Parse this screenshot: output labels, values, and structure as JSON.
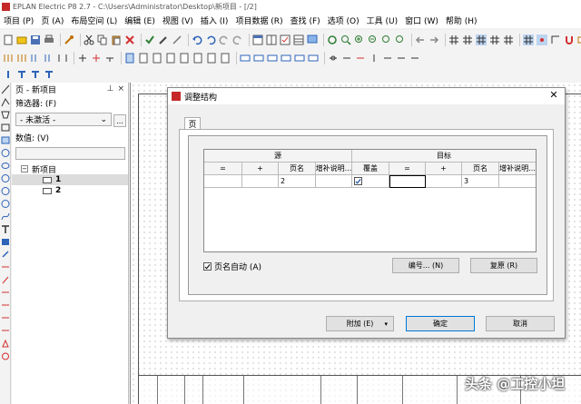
{
  "window": {
    "title": "EPLAN Electric P8 2.7 - C:\\Users\\Administrator\\Desktop\\新项目 - [/2]"
  },
  "menu": {
    "items": [
      "项目 (P)",
      "页 (A)",
      "布局空间 (L)",
      "编辑 (E)",
      "视图 (V)",
      "插入 (I)",
      "项目数据 (R)",
      "查找 (F)",
      "选项 (O)",
      "工具 (U)",
      "窗口 (W)",
      "帮助 (H)"
    ]
  },
  "navigator": {
    "title": "页 - 新项目",
    "pin_glyph": "⊥",
    "close_glyph": "×",
    "filter_label": "筛选器: (F)",
    "filter_value": "- 未激活 -",
    "more_btn": "...",
    "value_label": "数值: (V)",
    "tree_root": "新项目",
    "tree_pages": [
      "1",
      "2"
    ],
    "expand_glyph": "−",
    "combo_arrow": "⌄"
  },
  "dialog": {
    "title": "调整结构",
    "close_glyph": "✕",
    "tab_label": "页",
    "group_source": "源",
    "group_target": "目标",
    "columns": [
      "=",
      "+",
      "页名",
      "增补说明...",
      "覆盖",
      "=",
      "+",
      "页名",
      "增补说明..."
    ],
    "row": {
      "src_eq": "",
      "src_plus": "",
      "src_page": "2",
      "src_suppl": "",
      "overwrite_checked": true,
      "tgt_eq": "",
      "tgt_plus": "",
      "tgt_page": "3",
      "tgt_suppl": ""
    },
    "auto_page_name_checked": true,
    "auto_page_name_label": "页名自动 (A)",
    "number_btn": "编号... (N)",
    "restore_btn": "复原 (R)",
    "append_btn": "附加 (E)",
    "append_arrow": "▾",
    "ok_btn": "确定",
    "cancel_btn": "取消"
  },
  "watermark": "头条 @工控小坦",
  "colors": {
    "accent": "#0078d7",
    "brand": "#c62828"
  }
}
